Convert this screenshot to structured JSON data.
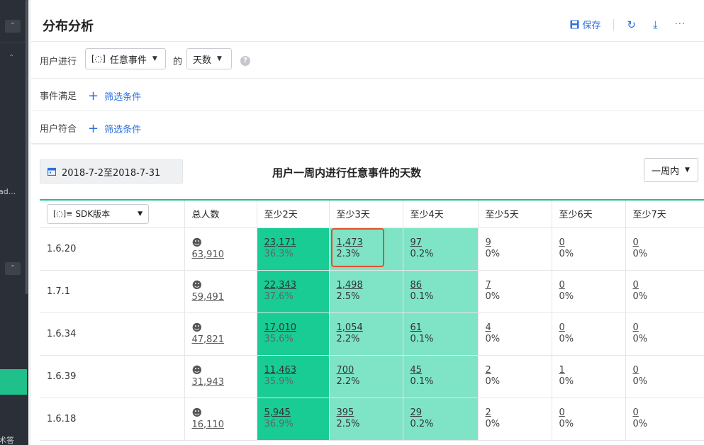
{
  "sidebar": {
    "partial_text_1": "ad...",
    "partial_text_2": "术答"
  },
  "header": {
    "title": "分布分析",
    "save_label": "保存"
  },
  "query": {
    "user_label": "用户进行",
    "event_dd": "任意事件",
    "of_label": "的",
    "metric_dd": "天数",
    "event_filter_label": "事件满足",
    "user_filter_label": "用户符合",
    "add_filter": "筛选条件"
  },
  "report": {
    "date_range": "2018-7-2至2018-7-31",
    "title": "用户一周内进行任意事件的天数",
    "period": "一周内"
  },
  "table": {
    "group_by": "SDK版本",
    "headers": [
      "总人数",
      "至少2天",
      "至少3天",
      "至少4天",
      "至少5天",
      "至少6天",
      "至少7天"
    ],
    "rows": [
      {
        "version": "1.6.20",
        "total": "63,910",
        "cells": [
          [
            "23,171",
            "36.3%"
          ],
          [
            "1,473",
            "2.3%"
          ],
          [
            "97",
            "0.2%"
          ],
          [
            "9",
            "0%"
          ],
          [
            "0",
            "0%"
          ],
          [
            "0",
            "0%"
          ]
        ]
      },
      {
        "version": "1.7.1",
        "total": "59,491",
        "cells": [
          [
            "22,343",
            "37.6%"
          ],
          [
            "1,498",
            "2.5%"
          ],
          [
            "86",
            "0.1%"
          ],
          [
            "7",
            "0%"
          ],
          [
            "0",
            "0%"
          ],
          [
            "0",
            "0%"
          ]
        ]
      },
      {
        "version": "1.6.34",
        "total": "47,821",
        "cells": [
          [
            "17,010",
            "35.6%"
          ],
          [
            "1,054",
            "2.2%"
          ],
          [
            "61",
            "0.1%"
          ],
          [
            "4",
            "0%"
          ],
          [
            "0",
            "0%"
          ],
          [
            "0",
            "0%"
          ]
        ]
      },
      {
        "version": "1.6.39",
        "total": "31,943",
        "cells": [
          [
            "11,463",
            "35.9%"
          ],
          [
            "700",
            "2.2%"
          ],
          [
            "45",
            "0.1%"
          ],
          [
            "2",
            "0%"
          ],
          [
            "1",
            "0%"
          ],
          [
            "0",
            "0%"
          ]
        ]
      },
      {
        "version": "1.6.18",
        "total": "16,110",
        "cells": [
          [
            "5,945",
            "36.9%"
          ],
          [
            "395",
            "2.5%"
          ],
          [
            "29",
            "0.2%"
          ],
          [
            "2",
            "0%"
          ],
          [
            "0",
            "0%"
          ],
          [
            "0",
            "0%"
          ]
        ]
      }
    ]
  },
  "colors": {
    "accent": "#20c08b",
    "dark_green": "#19cc94",
    "light_green": "#7fe4c6",
    "link_blue": "#2f6fe0",
    "highlight": "#e4502c"
  }
}
